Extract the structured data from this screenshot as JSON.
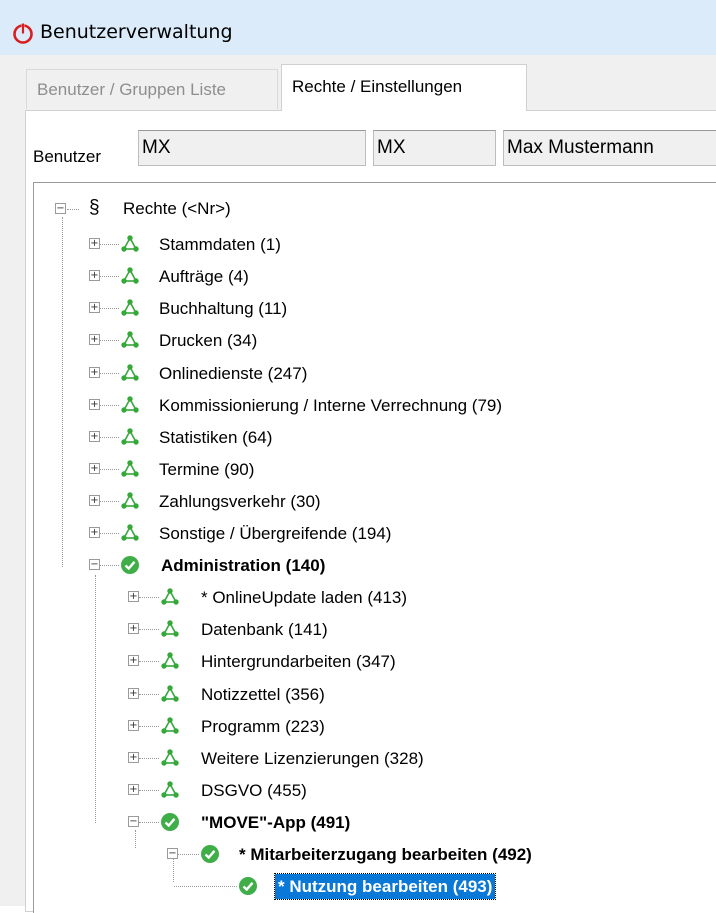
{
  "window": {
    "title": "Benutzerverwaltung"
  },
  "tabs": [
    {
      "label": "Benutzer / Gruppen Liste",
      "active": false
    },
    {
      "label": "Rechte / Einstellungen",
      "active": true
    }
  ],
  "user": {
    "label": "Benutzer",
    "field1": "MX",
    "field2": "MX",
    "field3": "Max Mustermann"
  },
  "tree": {
    "root": {
      "symbol": "§",
      "label": "Rechte (<Nr>)"
    },
    "top_items": [
      {
        "label": "Stammdaten (1)"
      },
      {
        "label": "Aufträge (4)"
      },
      {
        "label": "Buchhaltung (11)"
      },
      {
        "label": "Drucken (34)"
      },
      {
        "label": "Onlinedienste (247)"
      },
      {
        "label": "Kommissionierung / Interne Verrechnung (79)"
      },
      {
        "label": "Statistiken (64)"
      },
      {
        "label": "Termine (90)"
      },
      {
        "label": "Zahlungsverkehr (30)"
      },
      {
        "label": "Sonstige / Übergreifende (194)"
      },
      {
        "label": "Administration (140)"
      }
    ],
    "admin_items": [
      {
        "label": "* OnlineUpdate laden (413)"
      },
      {
        "label": "Datenbank (141)"
      },
      {
        "label": "Hintergrundarbeiten (347)"
      },
      {
        "label": "Notizzettel (356)"
      },
      {
        "label": "Programm (223)"
      },
      {
        "label": "Weitere Lizenzierungen (328)"
      },
      {
        "label": "DSGVO (455)"
      },
      {
        "label": "\"MOVE\"-App (491)"
      }
    ],
    "move_items": [
      {
        "label": "*  Mitarbeiterzugang bearbeiten (492)"
      }
    ],
    "leaf_items": [
      {
        "label": "*  Nutzung bearbeiten (493)"
      }
    ]
  },
  "colors": {
    "accent": "#0a78d7",
    "check_green": "#3fae49",
    "node_green": "#36a83a",
    "titlebar": "#dcebfa"
  }
}
